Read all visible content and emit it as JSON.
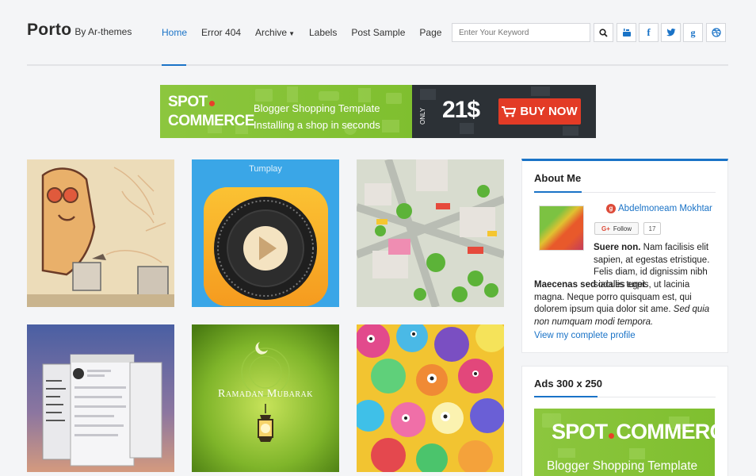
{
  "brand": {
    "name": "Porto",
    "by": "By Ar-themes"
  },
  "nav": {
    "items": [
      "Home",
      "Error 404",
      "Archive",
      "Labels",
      "Post Sample",
      "Page"
    ]
  },
  "search": {
    "placeholder": "Enter Your Keyword"
  },
  "social": [
    "search-icon",
    "youtube-icon",
    "facebook-icon",
    "twitter-icon",
    "google-plus-icon",
    "dribbble-icon"
  ],
  "banner": {
    "spot": "SPOT",
    "commerce": "COMMERCE",
    "line1": "Blogger Shopping Template",
    "line2": "Installing a shop in seconds",
    "only": "ONLY",
    "price": "21$",
    "buy": "BUY NOW"
  },
  "posts": [
    {
      "caption": ""
    },
    {
      "caption": "Tumplay"
    },
    {
      "caption": ""
    },
    {
      "caption": ""
    },
    {
      "caption": "Ramadan Mubarak"
    },
    {
      "caption": ""
    }
  ],
  "about": {
    "title": "About Me",
    "author": "Abdelmoneam Mokhtar",
    "follow": "Follow",
    "followers": "17",
    "text_bold1": "Suere non.",
    "text1": " Nam facilisis elit sapien, at egestas etristique. Felis diam, id dignissim nibh sodales eget.",
    "text_bold2": "Maecenas sed",
    "text2": " iaculis turpis, ut lacinia magna. Neque porro quisquam est, qui dolorem ipsum quia dolor sit ame.",
    "text_italic": " Sed quia non numquam modi tempora.",
    "profile_link": "View my complete profile"
  },
  "ads": {
    "title": "Ads 300 x 250",
    "spot": "SPOT",
    "commerce": "COMMERCE",
    "line": "Blogger Shopping Template"
  },
  "colors": {
    "accent": "#1a73c7",
    "green": "#8cc63e",
    "dark": "#2c3136",
    "red": "#e33b26"
  }
}
